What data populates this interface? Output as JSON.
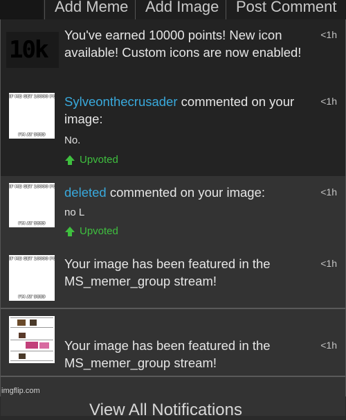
{
  "topbar": {
    "tabs": [
      "Add Meme",
      "Add Image",
      "Post Comment"
    ]
  },
  "notifications": [
    {
      "icon_text": "10k",
      "message": "You've earned 10000 points! New icon available! Custom icons are now enabled!",
      "time": "<1h"
    },
    {
      "thumb_top": "IF ME GET 10000 POINTS",
      "thumb_bottom": "I'M AT 9889",
      "user": "Sylveonthecrusader",
      "message": " commented on your image:",
      "comment": "No.",
      "vote": "Upvoted",
      "time": "<1h"
    },
    {
      "thumb_top": "IF ME GET 10000 POINTS",
      "thumb_bottom": "I'M AT 9889",
      "user": "deleted",
      "message": " commented on your image:",
      "comment": "no L",
      "vote": "Upvoted",
      "time": "<1h"
    },
    {
      "thumb_top": "IF ME GET 10000 POINTS",
      "thumb_bottom": "I'M AT 9889",
      "message": "Your image has been featured in the MS_memer_group stream!",
      "time": "<1h"
    },
    {
      "message": "Your image has been featured in the MS_memer_group stream!",
      "time": "<1h"
    }
  ],
  "footer": {
    "view_all": "View All Notifications"
  },
  "watermark": "imgflip.com",
  "colors": {
    "username": "#39a9dc",
    "upvote": "#3fbf3f"
  }
}
